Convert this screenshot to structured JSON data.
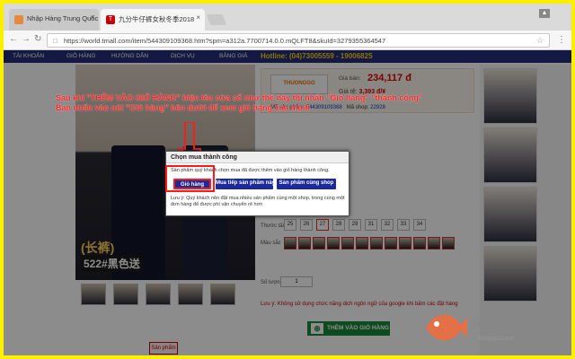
{
  "browser": {
    "tabs": [
      {
        "label": "Nhập Hàng Trung Quốc",
        "favicon_color": "#e8883a"
      },
      {
        "label": "九分牛仔裤女秋冬季2018",
        "favicon_color": "#c40000"
      }
    ],
    "url": "https://world.tmall.com/item/544309109368.htm?spm=a312a.7700714.0.0.mQLFT8&skuId=3279355364547"
  },
  "nav": {
    "items": [
      "TÀI KHOẢN",
      "GIỎ HÀNG",
      "HƯỚNG DẪN",
      "DỊCH VỤ",
      "BẢNG GIÁ"
    ],
    "hotline": "Hotline: (04)73005559 - 19006825"
  },
  "product": {
    "promo_top": "(长裤)",
    "promo_bottom": "522#黑色送",
    "price_label": "Giá bán:",
    "price": "234,117 đ",
    "cost_label": "Giá tệ:",
    "cost": "3,393 đ/¥",
    "logo_text": "THUONGGO",
    "codes_text": "Mã sản phẩm:",
    "product_code": "544309109368",
    "shop_label": "Mã shop:",
    "shop_code": "22928",
    "size_label": "Thước tấc",
    "sizes": [
      "25",
      "26",
      "27",
      "28",
      "29",
      "31",
      "32",
      "33",
      "34"
    ],
    "selected_size": "27",
    "color_label": "Màu sắc",
    "qty_label": "Số lượng",
    "qty_value": "1",
    "note": "Lưu ý: Không sử dụng chức năng dịch ngôn ngữ của google khi bấm các đặt hàng",
    "add_to_cart": "THÊM VÀO GIỎ HÀNG",
    "bottom_tab": "Sản phẩm"
  },
  "instruction": {
    "line1": "Sau khi \"THÊM VÀO GIỎ HÀNG\" hiện lên cửa sổ như thế này thì nhấn \"Giỏ hàng\" \"thành công\"",
    "line2": "Bạn nhấn vào nút \"Giỏ hàng\" bên dưới để xem giỏ hàng của mình"
  },
  "dialog": {
    "title": "Chọn mua thành công",
    "message": "Sản phẩm quý khách chọn mua đã được thêm vào giỏ hàng thành công.",
    "btn_cart": "Giỏ hàng",
    "btn_continue": "Mua tiếp sản phẩm này",
    "btn_shop": "Sản phẩm cùng shop",
    "info": "Lưu ý: Quý khách nên đặt mua nhiều sản phẩm cùng một shop, trong cùng một đơn hàng để được phí vận chuyển rẻ hơn"
  },
  "watermark": {
    "name": "网多鱼",
    "url": "wduoyu.com"
  },
  "colors": {
    "border": "#ffef00",
    "navbar": "#232f7a",
    "accent_red": "#ff2020",
    "button_blue": "#1b2a9e",
    "cart_green": "#1b8a3a"
  }
}
